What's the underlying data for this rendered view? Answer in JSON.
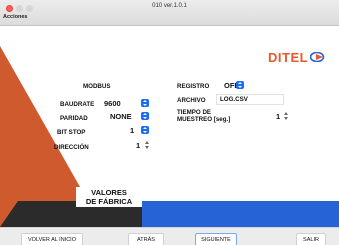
{
  "window": {
    "title": "010 ver.1.0.1"
  },
  "menu": {
    "actions_label": "Acciones"
  },
  "logo": {
    "text": "DITEL",
    "color": "#e8592b"
  },
  "modbus": {
    "section_label": "MODBUS",
    "baudrate": {
      "label": "BAUDRATE",
      "value": "9600"
    },
    "paridad": {
      "label": "PARIDAD",
      "value": "NONE"
    },
    "bit_stop": {
      "label": "BIT STOP",
      "value": "1"
    },
    "direccion": {
      "label": "DIRECCIÓN",
      "value": "1"
    }
  },
  "registro": {
    "label": "REGISTRO",
    "value": "OFF",
    "archivo": {
      "label": "ARCHIVO",
      "value": "LOG.CSV"
    },
    "tiempo": {
      "label_line1": "TIEMPO DE",
      "label_line2": "MUESTREO [seg.]",
      "value": "1"
    }
  },
  "factory": {
    "line1": "VALORES",
    "line2": "DE FÁBRICA"
  },
  "nav": {
    "home": "VOLVER AL INICIO",
    "back": "ATRÁS",
    "next": "SIGUIENTE",
    "exit": "SALIR"
  },
  "colors": {
    "accent_orange": "#cf5a2e",
    "accent_blue": "#2563d6",
    "dark": "#2b2b2b",
    "select_blue": "#1a6cf0"
  }
}
